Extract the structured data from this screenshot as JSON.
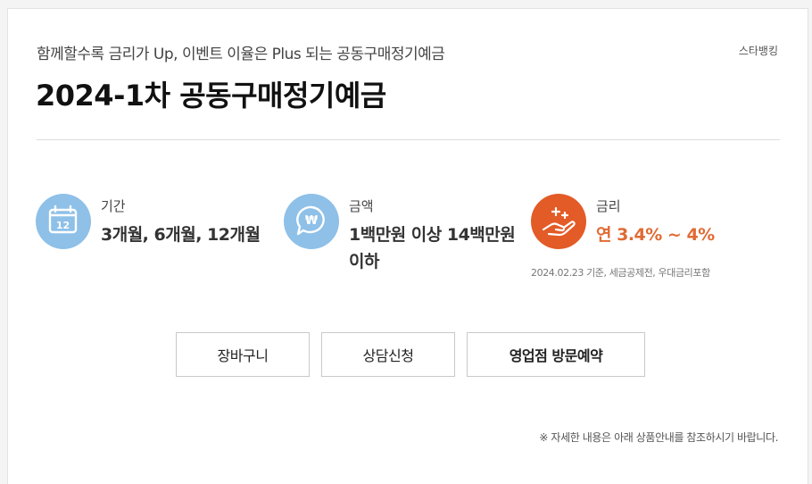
{
  "header": {
    "subtitle": "함께할수록 금리가 Up, 이벤트 이율은 Plus 되는 공동구매정기예금",
    "brand": "스타뱅킹",
    "title": "2024-1차 공동구매정기예금"
  },
  "info": {
    "period": {
      "label": "기간",
      "value": "3개월, 6개월, 12개월",
      "icon": "calendar-icon"
    },
    "amount": {
      "label": "금액",
      "value": "1백만원 이상 14백만원 이하",
      "icon": "won-chat-icon"
    },
    "rate": {
      "label": "금리",
      "value": "연 3.4% ~ 4%",
      "note": "2024.02.23 기준, 세금공제전, 우대금리포함",
      "icon": "hand-sparkle-icon"
    }
  },
  "buttons": {
    "cart": "장바구니",
    "consult": "상담신청",
    "visit": "영업점 방문예약"
  },
  "footnote": "※ 자세한 내용은 아래 상품안내를 참조하시기 바랍니다.",
  "colors": {
    "icon_blue": "#8ec0e8",
    "icon_orange": "#e35b26",
    "rate_text": "#e06a33"
  }
}
